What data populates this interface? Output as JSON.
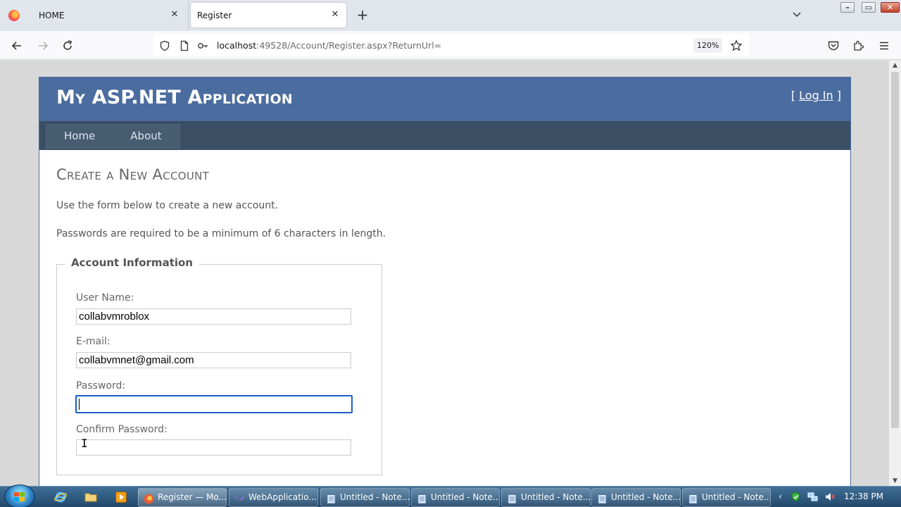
{
  "browser": {
    "tabs": [
      {
        "title": "HOME",
        "close": "✕"
      },
      {
        "title": "Register",
        "close": "✕"
      }
    ],
    "new_tab": "+",
    "url": {
      "host": "localhost",
      "rest": ":49528/Account/Register.aspx?ReturnUrl="
    },
    "zoom": "120%",
    "window_controls": {
      "minimize": "–",
      "maximize": "▭",
      "close": "✕"
    }
  },
  "site": {
    "title": "My ASP.NET Application",
    "login": {
      "open": "[ ",
      "link": "Log In",
      "close": " ]"
    },
    "menu": [
      "Home",
      "About"
    ]
  },
  "content": {
    "heading": "Create a New Account",
    "intro1": "Use the form below to create a new account.",
    "intro2": "Passwords are required to be a minimum of 6 characters in length.",
    "fieldset": {
      "legend": "Account Information",
      "username": {
        "label": "User Name:",
        "value": "collabvmroblox"
      },
      "email": {
        "label": "E-mail:",
        "value": "collabvmnet@gmail.com"
      },
      "password": {
        "label": "Password:",
        "value": ""
      },
      "confirm": {
        "label": "Confirm Password:",
        "value": ""
      }
    }
  },
  "taskbar": {
    "buttons": [
      {
        "label": "Register — Mo...",
        "icon": "firefox-icon"
      },
      {
        "label": "WebApplicatio...",
        "icon": "visual-studio-icon"
      },
      {
        "label": "Untitled - Note...",
        "icon": "notepad-icon"
      },
      {
        "label": "Untitled - Note...",
        "icon": "notepad-icon"
      },
      {
        "label": "Untitled - Note...",
        "icon": "notepad-icon"
      },
      {
        "label": "Untitled - Note...",
        "icon": "notepad-icon"
      },
      {
        "label": "Untitled - Note...",
        "icon": "notepad-icon"
      }
    ],
    "clock": "12:38 PM"
  },
  "colors": {
    "header": "#4b6c9e",
    "menu_bar": "#3a4f63",
    "focus": "#1761c9"
  }
}
